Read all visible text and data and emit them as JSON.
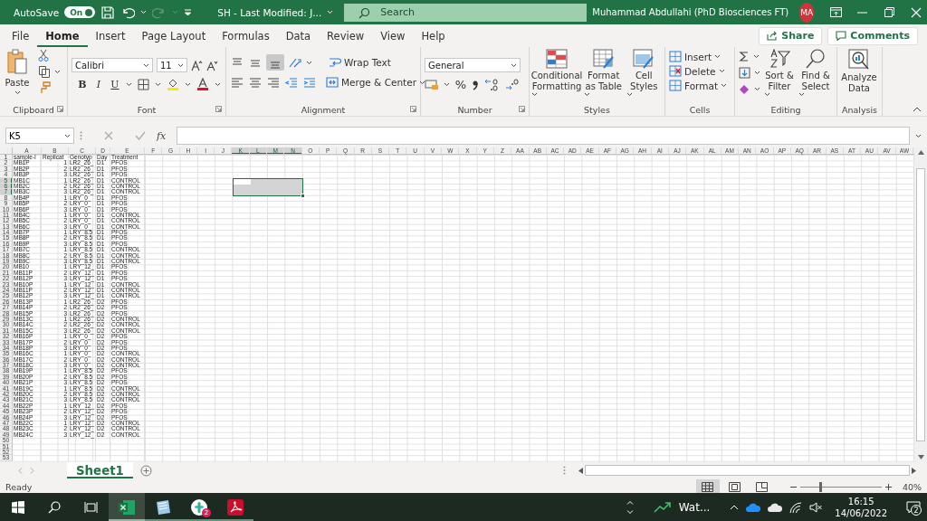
{
  "title_bar": {
    "autosave_label": "AutoSave",
    "autosave_toggle": {
      "label": "On",
      "on": true
    },
    "document_title": "SH  -  Last Modified: J...",
    "search": {
      "placeholder": "Search"
    },
    "user_name": "Muhammad Abdullahi (PhD Biosciences FT)",
    "avatar": "MA"
  },
  "menu_tabs": [
    {
      "label": "File",
      "selected": false
    },
    {
      "label": "Home",
      "selected": true
    },
    {
      "label": "Insert",
      "selected": false
    },
    {
      "label": "Page Layout",
      "selected": false
    },
    {
      "label": "Formulas",
      "selected": false
    },
    {
      "label": "Data",
      "selected": false
    },
    {
      "label": "Review",
      "selected": false
    },
    {
      "label": "View",
      "selected": false
    },
    {
      "label": "Help",
      "selected": false
    }
  ],
  "share": "Share",
  "comments": "Comments",
  "ribbon": {
    "clipboard": {
      "label": "Clipboard",
      "paste": "Paste"
    },
    "font": {
      "label": "Font",
      "family": "Calibri",
      "size": "11",
      "bold": "B",
      "italic": "I",
      "underline": "U"
    },
    "alignment": {
      "label": "Alignment",
      "wrap_text": "Wrap Text",
      "merge": "Merge & Center",
      "bottom_align": {
        "selected": true
      }
    },
    "number": {
      "label": "Number",
      "format": "General",
      "percent": "%"
    },
    "styles": {
      "label": "Styles",
      "buttons": [
        "Conditional Formatting",
        "Format as Table",
        "Cell Styles"
      ]
    },
    "cells": {
      "label": "Cells",
      "buttons": [
        "Insert",
        "Delete",
        "Format"
      ]
    },
    "editing": {
      "label": "Editing",
      "buttons": [
        "Sort & Filter",
        "Find & Select"
      ]
    },
    "analysis": {
      "label": "Analysis",
      "buttons": [
        "Analyze Data"
      ]
    }
  },
  "formula_bar": {
    "name_box": "K5",
    "fx": "fx"
  },
  "sheet": {
    "columns": [
      {
        "label": "A",
        "selected": false
      },
      {
        "label": "B",
        "selected": false
      },
      {
        "label": "C",
        "selected": false
      },
      {
        "label": "D",
        "selected": false
      },
      {
        "label": "E",
        "selected": false
      },
      {
        "label": "F",
        "selected": false
      },
      {
        "label": "G",
        "selected": false
      },
      {
        "label": "H",
        "selected": false
      },
      {
        "label": "I",
        "selected": false
      },
      {
        "label": "J",
        "selected": false
      },
      {
        "label": "K",
        "selected": true
      },
      {
        "label": "L",
        "selected": true
      },
      {
        "label": "M",
        "selected": true
      },
      {
        "label": "N",
        "selected": true
      },
      {
        "label": "O",
        "selected": false
      },
      {
        "label": "P",
        "selected": false
      },
      {
        "label": "Q",
        "selected": false
      },
      {
        "label": "R",
        "selected": false
      },
      {
        "label": "S",
        "selected": false
      },
      {
        "label": "T",
        "selected": false
      },
      {
        "label": "U",
        "selected": false
      },
      {
        "label": "V",
        "selected": false
      },
      {
        "label": "W",
        "selected": false
      },
      {
        "label": "X",
        "selected": false
      },
      {
        "label": "Y",
        "selected": false
      },
      {
        "label": "Z",
        "selected": false
      },
      {
        "label": "AA",
        "selected": false
      },
      {
        "label": "AB",
        "selected": false
      },
      {
        "label": "AC",
        "selected": false
      },
      {
        "label": "AD",
        "selected": false
      },
      {
        "label": "AE",
        "selected": false
      },
      {
        "label": "AF",
        "selected": false
      },
      {
        "label": "AG",
        "selected": false
      },
      {
        "label": "AH",
        "selected": false
      },
      {
        "label": "AI",
        "selected": false
      },
      {
        "label": "AJ",
        "selected": false
      },
      {
        "label": "AK",
        "selected": false
      },
      {
        "label": "AL",
        "selected": false
      },
      {
        "label": "AM",
        "selected": false
      },
      {
        "label": "AN",
        "selected": false
      },
      {
        "label": "AO",
        "selected": false
      },
      {
        "label": "AP",
        "selected": false
      },
      {
        "label": "AQ",
        "selected": false
      },
      {
        "label": "AR",
        "selected": false
      },
      {
        "label": "AS",
        "selected": false
      },
      {
        "label": "AT",
        "selected": false
      },
      {
        "label": "AU",
        "selected": false
      },
      {
        "label": "AV",
        "selected": false
      },
      {
        "label": "AW",
        "selected": false
      }
    ],
    "rows": [
      {
        "header": "1",
        "selected": false,
        "cells": [
          "sample-I",
          "Replicat",
          "Genotyp",
          "Day",
          "Treatment"
        ]
      },
      {
        "header": "2",
        "selected": false,
        "cells": [
          "MB1P",
          "1",
          "LR2_26_",
          "D1",
          "PFOS"
        ]
      },
      {
        "header": "3",
        "selected": false,
        "cells": [
          "MB2P",
          "2",
          "LR2_26_",
          "D1",
          "PFOS"
        ]
      },
      {
        "header": "4",
        "selected": false,
        "cells": [
          "MB3P",
          "3",
          "LR2_26_",
          "D1",
          "PFOS"
        ]
      },
      {
        "header": "5",
        "selected": true,
        "cells": [
          "MB1C",
          "1",
          "LR2_26_",
          "D1",
          "CONTROL"
        ]
      },
      {
        "header": "6",
        "selected": true,
        "cells": [
          "MB2C",
          "2",
          "LR2_26_",
          "D1",
          "CONTROL"
        ]
      },
      {
        "header": "7",
        "selected": true,
        "cells": [
          "MB3C",
          "3",
          "LR2_26_",
          "D1",
          "CONTROL"
        ]
      },
      {
        "header": "8",
        "selected": false,
        "cells": [
          "MB4P",
          "1",
          "LRY_0_",
          "D1",
          "PFOS"
        ]
      },
      {
        "header": "9",
        "selected": false,
        "cells": [
          "MB5P",
          "2",
          "LRY_0_",
          "D1",
          "PFOS"
        ]
      },
      {
        "header": "10",
        "selected": false,
        "cells": [
          "MB6P",
          "3",
          "LRY_0_",
          "D1",
          "PFOS"
        ]
      },
      {
        "header": "11",
        "selected": false,
        "cells": [
          "MB4C",
          "1",
          "LRY_0_",
          "D1",
          "CONTROL"
        ]
      },
      {
        "header": "12",
        "selected": false,
        "cells": [
          "MB5C",
          "2",
          "LRY_0_",
          "D1",
          "CONTROL"
        ]
      },
      {
        "header": "13",
        "selected": false,
        "cells": [
          "MB6C",
          "3",
          "LRY_0_",
          "D1",
          "CONTROL"
        ]
      },
      {
        "header": "14",
        "selected": false,
        "cells": [
          "MB7P",
          "1",
          "LRY_8.5",
          "D1",
          "PFOS"
        ]
      },
      {
        "header": "15",
        "selected": false,
        "cells": [
          "MB8P",
          "2",
          "LRY_8.5",
          "D1",
          "PFOS"
        ]
      },
      {
        "header": "16",
        "selected": false,
        "cells": [
          "MB9P",
          "3",
          "LRY_8.5",
          "D1",
          "PFOS"
        ]
      },
      {
        "header": "17",
        "selected": false,
        "cells": [
          "MB7C",
          "1",
          "LRY_8.5",
          "D1",
          "CONTROL"
        ]
      },
      {
        "header": "18",
        "selected": false,
        "cells": [
          "MB8C",
          "2",
          "LRY_8.5",
          "D1",
          "CONTROL"
        ]
      },
      {
        "header": "19",
        "selected": false,
        "cells": [
          "MB9C",
          "3",
          "LRY_8.5",
          "D1",
          "CONTROL"
        ]
      },
      {
        "header": "20",
        "selected": false,
        "cells": [
          "MB10",
          "1",
          "LRY_12_",
          "D1",
          "PFOS"
        ]
      },
      {
        "header": "21",
        "selected": false,
        "cells": [
          "MB11P",
          "2",
          "LRY_12_",
          "D1",
          "PFOS"
        ]
      },
      {
        "header": "22",
        "selected": false,
        "cells": [
          "MB12P",
          "3",
          "LRY_12_",
          "D1",
          "PFOS"
        ]
      },
      {
        "header": "23",
        "selected": false,
        "cells": [
          "MB10P",
          "1",
          "LRY_12_",
          "D1",
          "CONTROL"
        ]
      },
      {
        "header": "24",
        "selected": false,
        "cells": [
          "MB11P",
          "2",
          "LRY_12_",
          "D1",
          "CONTROL"
        ]
      },
      {
        "header": "25",
        "selected": false,
        "cells": [
          "MB12P",
          "3",
          "LRY_12_",
          "D1",
          "CONTROL"
        ]
      },
      {
        "header": "26",
        "selected": false,
        "cells": [
          "MB13P",
          "1",
          "LR2_26_",
          "D2",
          "PFOS"
        ]
      },
      {
        "header": "27",
        "selected": false,
        "cells": [
          "MB14P",
          "2",
          "LR2_26_",
          "D2",
          "PFOS"
        ]
      },
      {
        "header": "28",
        "selected": false,
        "cells": [
          "MB15P",
          "3",
          "LR2_26_",
          "D2",
          "PFOS"
        ]
      },
      {
        "header": "29",
        "selected": false,
        "cells": [
          "MB13C",
          "1",
          "LR2_26_",
          "D2",
          "CONTROL"
        ]
      },
      {
        "header": "30",
        "selected": false,
        "cells": [
          "MB14C",
          "2",
          "LR2_26_",
          "D2",
          "CONTROL"
        ]
      },
      {
        "header": "31",
        "selected": false,
        "cells": [
          "MB15C",
          "3",
          "LR2_26_",
          "D2",
          "CONTROL"
        ]
      },
      {
        "header": "32",
        "selected": false,
        "cells": [
          "MB16P",
          "1",
          "LRY_0_",
          "D2",
          "PFOS"
        ]
      },
      {
        "header": "33",
        "selected": false,
        "cells": [
          "MB17P",
          "2",
          "LRY_0_",
          "D2",
          "PFOS"
        ]
      },
      {
        "header": "34",
        "selected": false,
        "cells": [
          "MB18P",
          "3",
          "LRY_0_",
          "D2",
          "PFOS"
        ]
      },
      {
        "header": "35",
        "selected": false,
        "cells": [
          "MB16C",
          "1",
          "LRY_0_",
          "D2",
          "CONTROL"
        ]
      },
      {
        "header": "36",
        "selected": false,
        "cells": [
          "MB17C",
          "2",
          "LRY_0_",
          "D2",
          "CONTROL"
        ]
      },
      {
        "header": "37",
        "selected": false,
        "cells": [
          "MB18C",
          "3",
          "LRY_0_",
          "D2",
          "CONTROL"
        ]
      },
      {
        "header": "38",
        "selected": false,
        "cells": [
          "MB19P",
          "1",
          "LRY_8.5",
          "D2",
          "PFOS"
        ]
      },
      {
        "header": "39",
        "selected": false,
        "cells": [
          "MB20P",
          "2",
          "LRY_8.5",
          "D2",
          "PFOS"
        ]
      },
      {
        "header": "40",
        "selected": false,
        "cells": [
          "MB21P",
          "3",
          "LRY_8.5",
          "D2",
          "PFOS"
        ]
      },
      {
        "header": "41",
        "selected": false,
        "cells": [
          "MB19C",
          "1",
          "LRY_8.5",
          "D2",
          "CONTROL"
        ]
      },
      {
        "header": "42",
        "selected": false,
        "cells": [
          "MB20C",
          "2",
          "LRY_8.5",
          "D2",
          "CONTROL"
        ]
      },
      {
        "header": "43",
        "selected": false,
        "cells": [
          "MB21C",
          "3",
          "LRY_8.5",
          "D2",
          "CONTROL"
        ]
      },
      {
        "header": "44",
        "selected": false,
        "cells": [
          "MB22P",
          "1",
          "LRY_12_",
          "D2",
          "PFOS"
        ]
      },
      {
        "header": "45",
        "selected": false,
        "cells": [
          "MB23P",
          "2",
          "LRY_12_",
          "D2",
          "PFOS"
        ]
      },
      {
        "header": "46",
        "selected": false,
        "cells": [
          "MB24P",
          "3",
          "LRY_12_",
          "D2",
          "PFOS"
        ]
      },
      {
        "header": "47",
        "selected": false,
        "cells": [
          "MB22C",
          "1",
          "LRY_12_",
          "D2",
          "CONTROL"
        ]
      },
      {
        "header": "48",
        "selected": false,
        "cells": [
          "MB23C",
          "2",
          "LRY_12_",
          "D2",
          "CONTROL"
        ]
      },
      {
        "header": "49",
        "selected": false,
        "cells": [
          "MB24C",
          "3",
          "LRY_12_",
          "D2",
          "CONTROL"
        ]
      },
      {
        "header": "50",
        "selected": false
      },
      {
        "header": "51",
        "selected": false
      },
      {
        "header": "52",
        "selected": false
      },
      {
        "header": "53",
        "selected": false
      }
    ]
  },
  "sheet_tabs": [
    {
      "label": "Sheet1",
      "selected": true
    }
  ],
  "status_bar": {
    "status": "Ready",
    "zoom": {
      "level": 0.25,
      "label": "40%"
    }
  },
  "taskbar": {
    "apps": [
      {
        "kind": "excel",
        "selected": true
      },
      {
        "kind": "notes",
        "selected": false
      },
      {
        "kind": "chat",
        "selected": false,
        "badge": "2"
      },
      {
        "kind": "pdf",
        "selected": false
      }
    ],
    "weather": "Wat...",
    "time": "16:15",
    "date": "14/06/2022",
    "notifications": "2"
  }
}
